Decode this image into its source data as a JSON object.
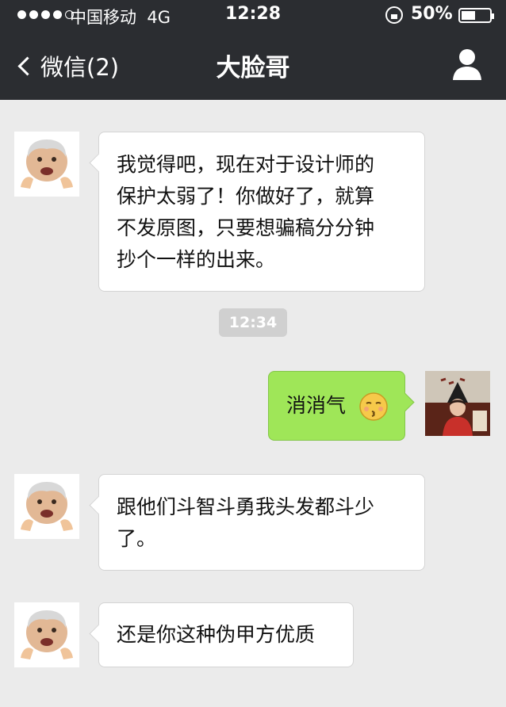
{
  "status_bar": {
    "carrier": "中国移动",
    "network": "4G",
    "time": "12:28",
    "battery": "50%",
    "battery_level": 0.5
  },
  "nav": {
    "back_label": "微信(2)",
    "title": "大脸哥"
  },
  "messages": [
    {
      "side": "in",
      "text_lines": [
        "我觉得吧，现在对于设计师的",
        "保护太弱了！你做好了，就算",
        "不发原图，只要想骗稿分分钟",
        "抄个一样的出来。"
      ]
    },
    {
      "timestamp": "12:34"
    },
    {
      "side": "out",
      "text": "消消气"
    },
    {
      "side": "in",
      "text_lines": [
        "跟他们斗智斗勇我头发都斗少",
        "了。"
      ]
    },
    {
      "side": "in",
      "text": "还是你这种伪甲方优质"
    }
  ],
  "colors": {
    "header_bg": "#2b2d31",
    "chat_bg": "#ebebeb",
    "outgoing_bubble": "#9fe658"
  }
}
